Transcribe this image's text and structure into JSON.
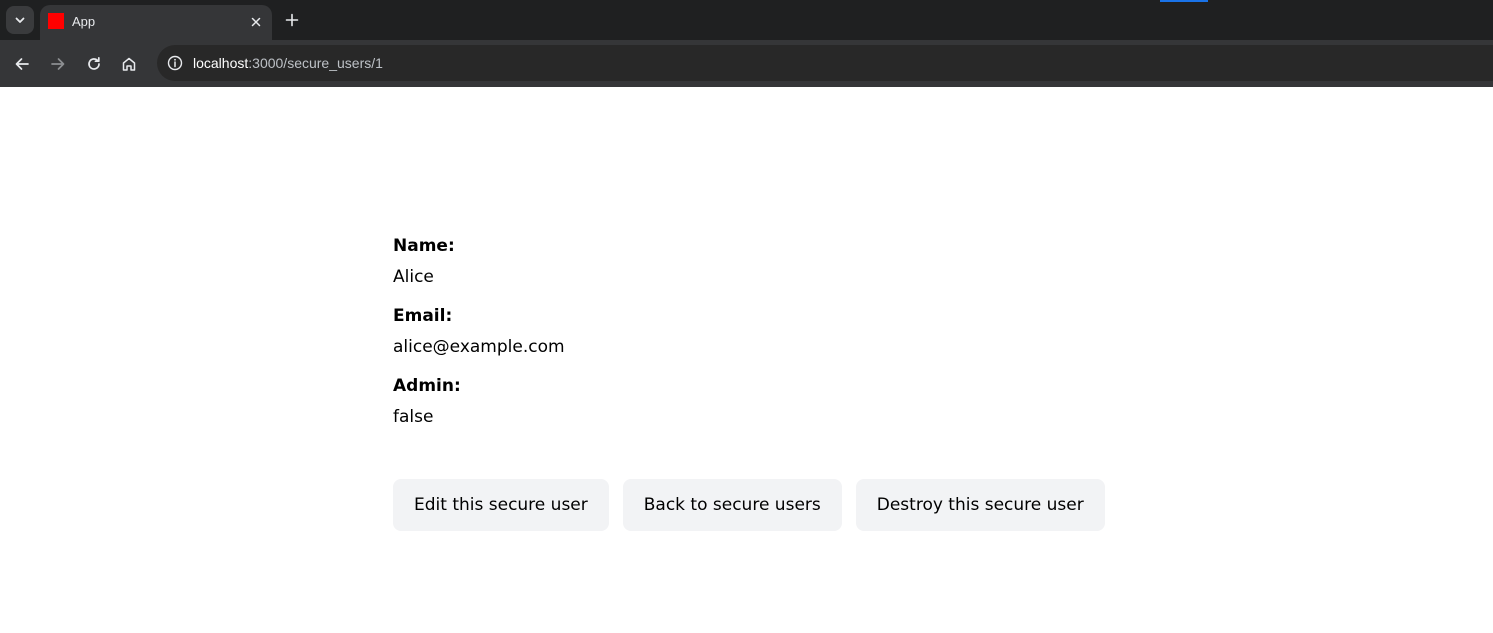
{
  "browser": {
    "tab": {
      "title": "App",
      "favicon_color": "#ff0000"
    },
    "address": {
      "host": "localhost",
      "path": ":3000/secure_users/1"
    },
    "icons": {
      "tab_search": "chevron-down-icon",
      "tab_close": "close-icon",
      "new_tab": "plus-icon",
      "back": "arrow-left-icon",
      "forward": "arrow-right-icon",
      "reload": "reload-icon",
      "home": "home-icon",
      "site_info": "info-icon"
    }
  },
  "user": {
    "name_label": "Name:",
    "name_value": "Alice",
    "email_label": "Email:",
    "email_value": "alice@example.com",
    "admin_label": "Admin:",
    "admin_value": "false"
  },
  "actions": {
    "edit_label": "Edit this secure user",
    "back_label": "Back to secure users",
    "destroy_label": "Destroy this secure user"
  },
  "colors": {
    "tabstrip_bg": "#1f2021",
    "toolbar_bg": "#353638",
    "button_bg": "#f2f3f5",
    "accent": "#1a73e8"
  }
}
